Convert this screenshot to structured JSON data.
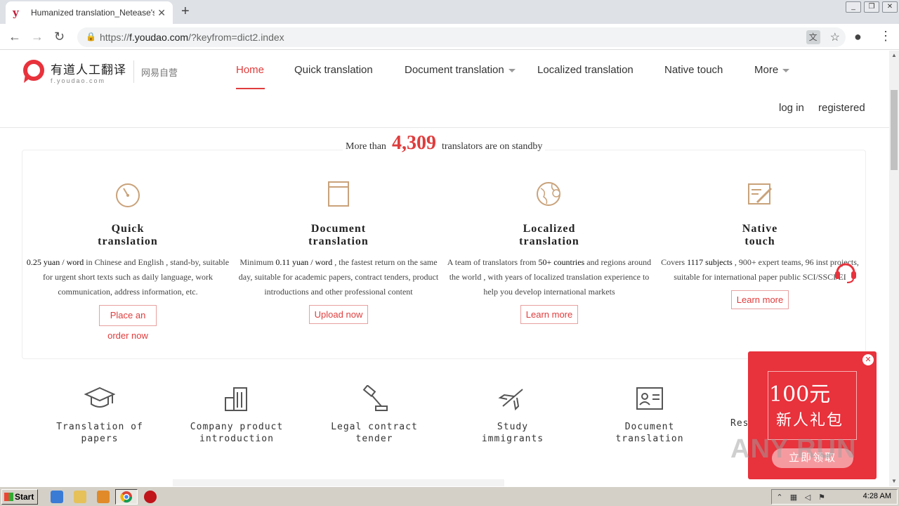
{
  "browser": {
    "tab_title": "Humanized translation_Netease's pr",
    "tab_favicon_letter": "y",
    "url_prefix": "https://",
    "url_host": "f.youdao.com",
    "url_path": "/?keyfrom=dict2.index"
  },
  "header": {
    "logo_cn": "有道人工翻译",
    "logo_domain": "f.youdao.com",
    "logo_sub": "网易自营",
    "nav": [
      "Home",
      "Quick translation",
      "Document translation",
      "Localized translation",
      "Native touch",
      "More"
    ],
    "login": "log in",
    "register": "registered"
  },
  "standby": {
    "prefix": "More than",
    "count": "4,309",
    "suffix": "translators are on standby"
  },
  "services": [
    {
      "title_line1": "Quick",
      "title_line2": "translation",
      "desc_strong": "0.25 yuan / word",
      "desc": " in Chinese and English , stand-by, suitable for urgent short texts such as daily language, work communication, address information, etc.",
      "button": "Place an",
      "button_line2": "order now",
      "icon": "stopwatch-icon"
    },
    {
      "title_line1": "Document",
      "title_line2": "translation",
      "desc_pre": "Minimum ",
      "desc_strong": "0.11 yuan / word",
      "desc": " , the fastest return on the same day, suitable for academic papers, contract tenders, product introductions and other professional content",
      "button": "Upload now",
      "icon": "document-icon"
    },
    {
      "title_line1": "Localized",
      "title_line2": "translation",
      "desc_pre": "A team of translators from ",
      "desc_strong": "50+ countries",
      "desc": " and regions around the world , with years of localized translation experience to help you develop international markets",
      "button": "Learn more",
      "icon": "globe-pin-icon"
    },
    {
      "title_line1": "Native",
      "title_line2": "touch",
      "desc_pre": "Covers ",
      "desc_strong": "1117 subjects",
      "desc": " , 900+ expert teams, 96 inst projects, suitable for international paper public SCI/SSCI/EI",
      "button": "Learn more",
      "icon": "edit-pen-icon"
    }
  ],
  "categories": [
    {
      "label": "Translation of papers",
      "icon": "graduation-cap-icon"
    },
    {
      "label": "Company product introduction",
      "icon": "buildings-icon"
    },
    {
      "label": "Legal contract tender",
      "icon": "gavel-icon"
    },
    {
      "label": "Study immigrants",
      "icon": "airplane-icon"
    },
    {
      "label": "Document translation",
      "icon": "id-card-icon"
    },
    {
      "label": "Res",
      "icon": "research-icon"
    }
  ],
  "promo": {
    "amount": "100元",
    "title": "新人礼包",
    "button": "立即领取"
  },
  "watermark": "ANY RUN",
  "taskbar": {
    "start": "Start",
    "time": "4:28 AM"
  },
  "colors": {
    "accent": "#e03c3c",
    "icon_gold": "#c9a27a",
    "promo_red": "#e8323c"
  }
}
